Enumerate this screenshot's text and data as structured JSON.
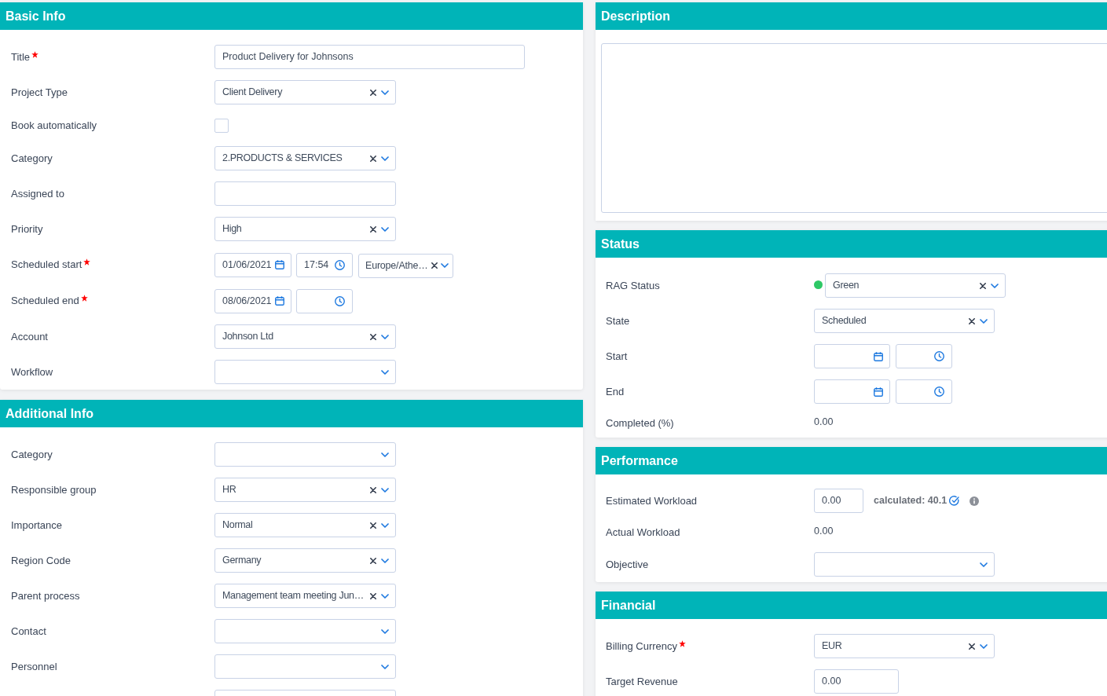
{
  "basic_info": {
    "title": "Basic Info",
    "fields": [
      {
        "kind": "text",
        "label": "Title",
        "required": true,
        "wide": true,
        "value": "Product Delivery for Johnsons"
      },
      {
        "kind": "select",
        "label": "Project Type",
        "required": false,
        "value": "Client Delivery"
      },
      {
        "kind": "checkbox",
        "label": "Book automatically",
        "required": false,
        "checked": false
      },
      {
        "kind": "select",
        "label": "Category",
        "required": false,
        "value": "2.PRODUCTS & SERVICES"
      },
      {
        "kind": "text",
        "label": "Assigned to",
        "required": false,
        "wide": false
      },
      {
        "kind": "select",
        "label": "Priority",
        "required": false,
        "value": "High"
      },
      {
        "kind": "datetime",
        "label": "Scheduled start",
        "required": true,
        "date": "01/06/2021",
        "time": "17:54",
        "timezone": "Europe/Athe…"
      },
      {
        "kind": "datetime",
        "label": "Scheduled end",
        "required": true,
        "date": "08/06/2021"
      },
      {
        "kind": "select",
        "label": "Account",
        "required": false,
        "value": "Johnson Ltd"
      },
      {
        "kind": "select",
        "label": "Workflow",
        "required": false
      }
    ]
  },
  "additional_info": {
    "title": "Additional Info",
    "fields": [
      {
        "kind": "select",
        "label": "Category",
        "required": false
      },
      {
        "kind": "select",
        "label": "Responsible group",
        "required": false,
        "value": "HR"
      },
      {
        "kind": "select",
        "label": "Importance",
        "required": false,
        "value": "Normal"
      },
      {
        "kind": "select",
        "label": "Region Code",
        "required": false,
        "value": "Germany"
      },
      {
        "kind": "select",
        "label": "Parent process",
        "required": false,
        "value": "Management team meeting Jun…"
      },
      {
        "kind": "select",
        "label": "Contact",
        "required": false
      },
      {
        "kind": "select",
        "label": "Personnel",
        "required": false
      },
      {
        "kind": "select"
      }
    ]
  },
  "description": {
    "title": "Description"
  },
  "status": {
    "title": "Status",
    "fields": [
      {
        "kind": "select",
        "label": "RAG Status",
        "required": false,
        "value": "Green",
        "color": "#2ec866"
      },
      {
        "kind": "select",
        "label": "State",
        "required": false,
        "value": "Scheduled"
      },
      {
        "kind": "datetime",
        "label": "Start",
        "required": false
      },
      {
        "kind": "datetime",
        "label": "End",
        "required": false
      },
      {
        "kind": "readonly",
        "label": "Completed (%)",
        "required": false,
        "value": "0.00"
      }
    ]
  },
  "performance": {
    "title": "Performance",
    "fields": [
      {
        "kind": "workload",
        "label": "Estimated Workload",
        "required": false,
        "value": "0.00",
        "calculated": "calculated: 40.1"
      },
      {
        "kind": "readonly",
        "label": "Actual Workload",
        "required": false,
        "value": "0.00"
      },
      {
        "kind": "select",
        "label": "Objective",
        "required": false
      }
    ]
  },
  "financial": {
    "title": "Financial",
    "fields": [
      {
        "kind": "select",
        "label": "Billing Currency",
        "required": true,
        "value": "EUR"
      },
      {
        "kind": "number",
        "label": "Target Revenue",
        "required": false,
        "value": "0.00"
      }
    ]
  }
}
